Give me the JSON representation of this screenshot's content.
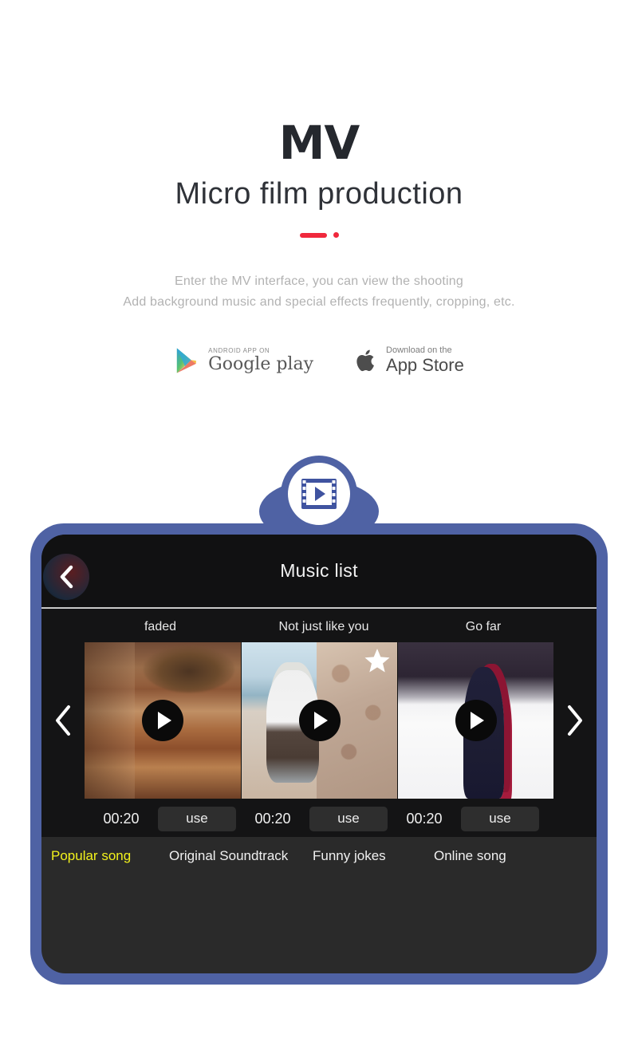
{
  "hero": {
    "title": "MV",
    "subtitle": "Micro film production",
    "description_line1": "Enter the MV interface, you can view the shooting",
    "description_line2": "Add background music and special effects frequently, cropping, etc.",
    "accent_color": "#f0283c"
  },
  "stores": {
    "google": {
      "small": "ANDROID APP ON",
      "big": "Google play",
      "icon": "google-play-icon"
    },
    "apple": {
      "small": "Download on the",
      "big": "App Store",
      "icon": "apple-icon"
    }
  },
  "badge": {
    "icon": "film-play-icon",
    "frame_color": "#4f62a4"
  },
  "app": {
    "header": {
      "title": "Music list",
      "back_icon": "chevron-left-icon"
    },
    "nav": {
      "prev_icon": "chevron-left-icon",
      "next_icon": "chevron-right-icon"
    },
    "songs": [
      {
        "title": "faded",
        "duration": "00:20",
        "use_label": "use",
        "play_icon": "play-icon",
        "starred": false,
        "art": "books"
      },
      {
        "title": "Not just like you",
        "duration": "00:20",
        "use_label": "use",
        "play_icon": "play-icon",
        "starred": true,
        "star_icon": "star-icon",
        "art": "boy-on-wall"
      },
      {
        "title": "Go far",
        "duration": "00:20",
        "use_label": "use",
        "play_icon": "play-icon",
        "starred": false,
        "art": "woman-in-snow"
      }
    ],
    "tabs": [
      {
        "label": "Popular song",
        "active": true
      },
      {
        "label": "Original Soundtrack",
        "active": false
      },
      {
        "label": "Funny jokes",
        "active": false
      },
      {
        "label": "Online song",
        "active": false
      }
    ],
    "active_tab_color": "#f2f21c"
  }
}
